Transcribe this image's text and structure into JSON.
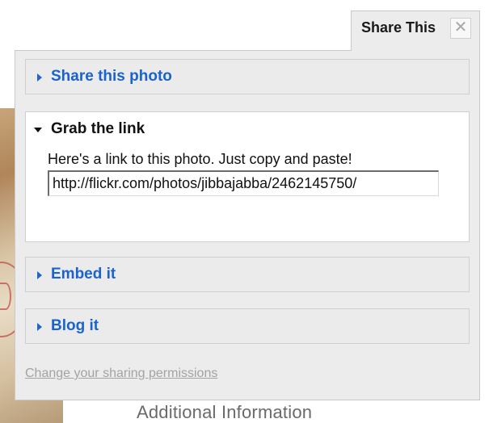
{
  "tab": {
    "title": "Share This",
    "close_glyph": "✕"
  },
  "sections": {
    "share_photo": {
      "label": "Share this photo",
      "state": "collapsed"
    },
    "grab_link": {
      "label": "Grab the link",
      "state": "expanded",
      "description": "Here's a link to this photo. Just copy and paste!",
      "url": "http://flickr.com/photos/jibbajabba/2462145750/"
    },
    "embed": {
      "label": "Embed it",
      "state": "collapsed"
    },
    "blog": {
      "label": "Blog it",
      "state": "collapsed"
    }
  },
  "footer": {
    "permissions_link": "Change your sharing permissions"
  },
  "background": {
    "additional_info": "Additional Information"
  },
  "icons": {
    "collapsed": "triangle-right-icon",
    "expanded": "triangle-down-icon",
    "close": "close-icon"
  },
  "colors": {
    "link_blue": "#1a63cf",
    "panel_bg": "#ececec",
    "muted_link": "#a3a3a3"
  }
}
